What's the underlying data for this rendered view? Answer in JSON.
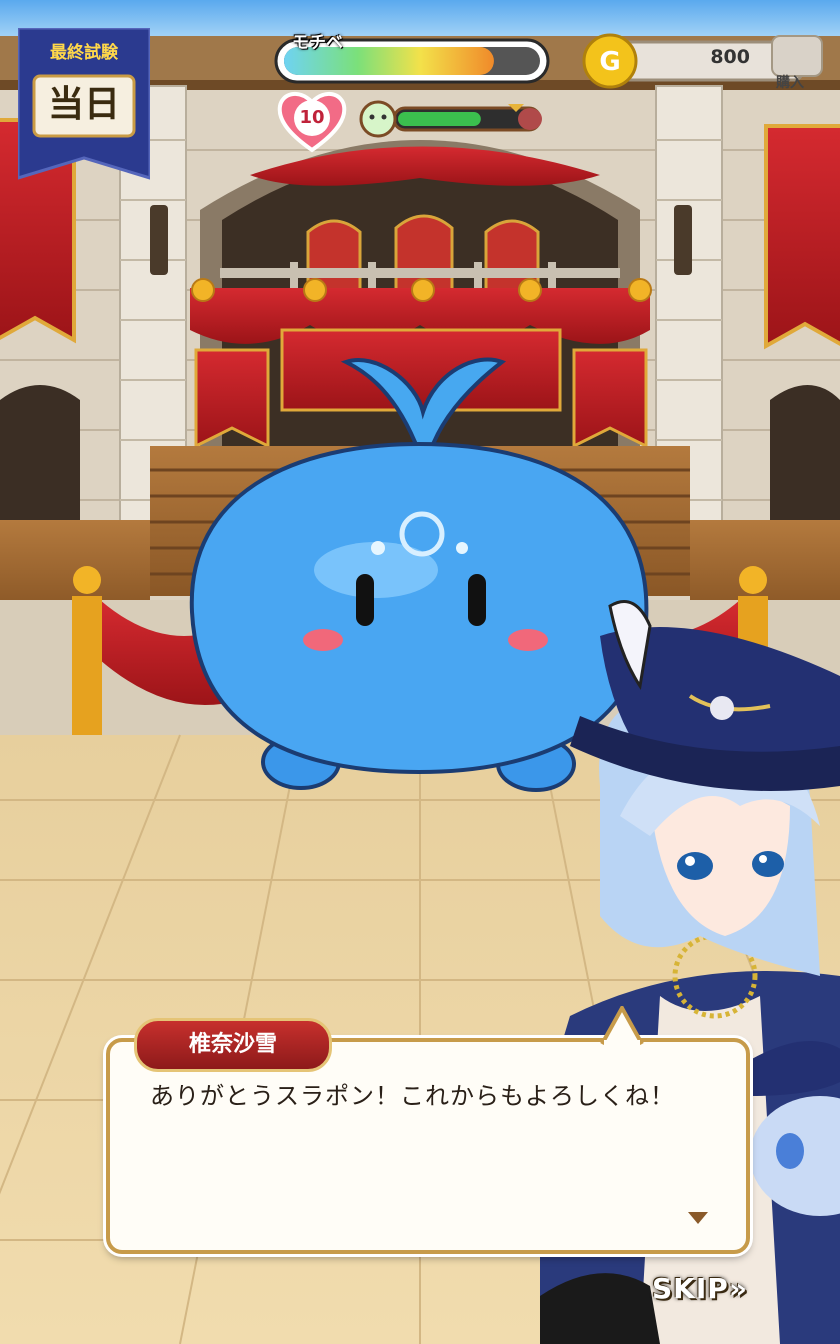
{
  "hud": {
    "exam_banner": {
      "title": "最終試験",
      "day": "当日"
    },
    "mochibe": {
      "label": "モチベ",
      "level": 0.82
    },
    "coins": {
      "value": "800",
      "buy_label": "購入"
    },
    "heart": {
      "value": "10"
    },
    "progress_fraction": 0.6
  },
  "dialog": {
    "speaker": "椎奈沙雪",
    "text": "ありがとうスラポン！これからもよろしくね！"
  },
  "controls": {
    "skip_label": "SKIP"
  },
  "colors": {
    "banner_blue": "#2b3a8f",
    "coin_gold": "#f3c31b",
    "curtain_red": "#c5202a",
    "slime_blue": "#48a4f2",
    "speaker_red": "#b42525"
  }
}
